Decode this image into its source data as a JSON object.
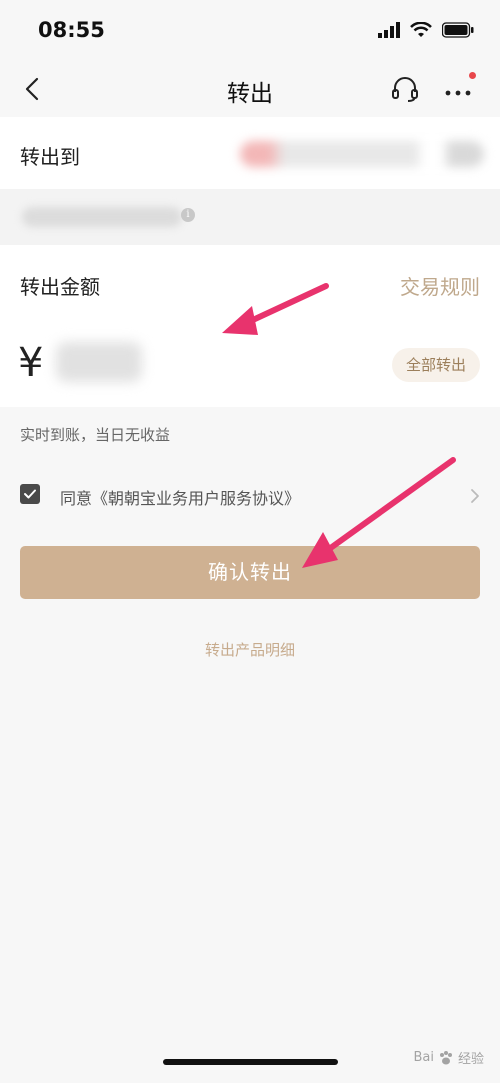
{
  "status_bar": {
    "time": "08:55"
  },
  "nav": {
    "title": "转出"
  },
  "transfer_to": {
    "label": "转出到"
  },
  "amount": {
    "label": "转出金额",
    "rules_link": "交易规则",
    "currency_symbol": "¥",
    "all_out_button": "全部转出"
  },
  "note": {
    "arrival": "实时到账，当日无收益"
  },
  "agreement": {
    "text": "同意《朝朝宝业务用户服务协议》",
    "checked": true
  },
  "confirm_button": {
    "label": "确认转出"
  },
  "detail_link": {
    "label": "转出产品明细"
  },
  "watermark": {
    "text": "经验",
    "brand": "Bai"
  },
  "colors": {
    "accent": "#cfb192",
    "link": "#bfa88c",
    "annotation_arrow": "#e8336d"
  }
}
